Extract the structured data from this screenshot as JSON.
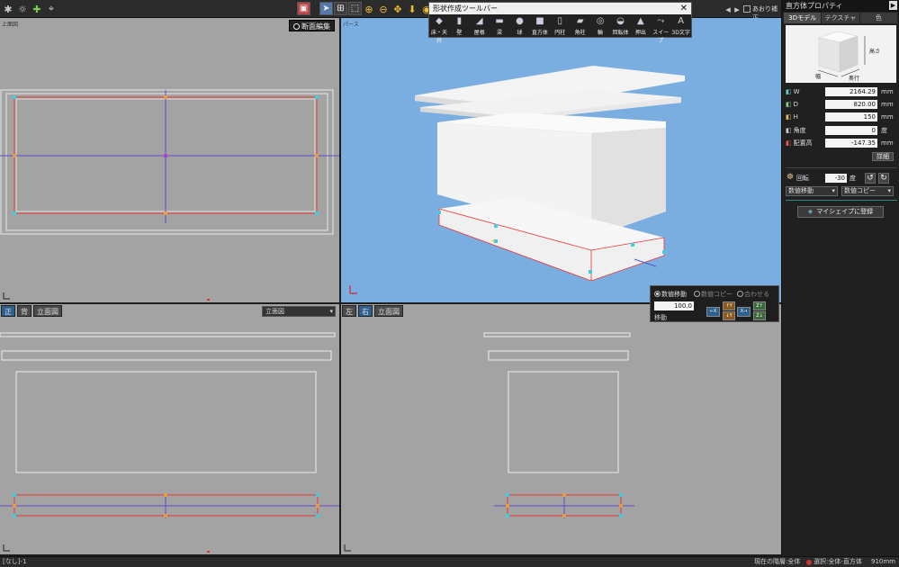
{
  "status_bar": {
    "left": "[なし]-1",
    "floor": "現在の階層:全体",
    "selection": "選択:全体-直方体",
    "dim": "910mm"
  },
  "topbar": {
    "snap_label": "あおり補正",
    "toolbar_title": "形状作成ツールバー"
  },
  "shape_tools": [
    {
      "label": "床・天井",
      "icon": "floor-ceiling-icon",
      "glyph": "◆"
    },
    {
      "label": "壁",
      "icon": "wall-icon",
      "glyph": "▮"
    },
    {
      "label": "屋根",
      "icon": "roof-icon",
      "glyph": "◢"
    },
    {
      "label": "梁",
      "icon": "beam-icon",
      "glyph": "▬"
    },
    {
      "label": "球",
      "icon": "sphere-icon",
      "glyph": "●"
    },
    {
      "label": "直方体",
      "icon": "box-icon",
      "glyph": "■"
    },
    {
      "label": "円柱",
      "icon": "cylinder-icon",
      "glyph": "▯"
    },
    {
      "label": "角柱",
      "icon": "prism-icon",
      "glyph": "▰"
    },
    {
      "label": "輪",
      "icon": "ring-icon",
      "glyph": "◎"
    },
    {
      "label": "回転体",
      "icon": "lathe-icon",
      "glyph": "◒"
    },
    {
      "label": "押出",
      "icon": "extrude-icon",
      "glyph": "▲"
    },
    {
      "label": "スイープ",
      "icon": "sweep-icon",
      "glyph": "⤳"
    },
    {
      "label": "3D文字",
      "icon": "3d-text-icon",
      "glyph": "A"
    }
  ],
  "viewports": {
    "top_left_label": "上面図",
    "section_edit_label": "断面編集",
    "perspective_label": "パース",
    "bottom_left_tabs": [
      "正",
      "背",
      "立面図"
    ],
    "bottom_left_dropdown": "立面図",
    "bottom_right_tabs": [
      "左",
      "右",
      "立面図"
    ]
  },
  "move_panel": {
    "options": [
      "数値移動",
      "数値コピー",
      "合わせる"
    ],
    "value": "100.0",
    "move_label": "移動",
    "buttons": [
      "←X",
      "X→",
      "↑Y",
      "↓Y",
      "Z↑",
      "Z↓"
    ]
  },
  "properties": {
    "title": "直方体プロパティ",
    "tabs": [
      "3Dモデル",
      "テクスチャ",
      "色"
    ],
    "preview": {
      "height_label": "高さ",
      "width_label": "幅",
      "depth_label": "奥行"
    },
    "fields": [
      {
        "label": "W",
        "value": "2164.29",
        "unit": "mm",
        "icon": "width-icon"
      },
      {
        "label": "D",
        "value": "820.00",
        "unit": "mm",
        "icon": "depth-icon"
      },
      {
        "label": "H",
        "value": "150",
        "unit": "mm",
        "icon": "height-icon"
      },
      {
        "label": "角度",
        "value": "0",
        "unit": "度",
        "icon": "angle-icon"
      },
      {
        "label": "配置高",
        "value": "-147.35",
        "unit": "mm",
        "icon": "placement-height-icon"
      }
    ],
    "detail_button": "詳細",
    "rotation": {
      "label": "回転",
      "value": "-30",
      "unit": "度"
    },
    "move_dropdown": "数値移動",
    "copy_dropdown": "数値コピー",
    "register_button": "マイシェイプに登録"
  },
  "colors": {
    "viewport_bg": "#a3a3a3",
    "perspective_bg": "#7aaee0",
    "accent": "#2d5f8f"
  }
}
